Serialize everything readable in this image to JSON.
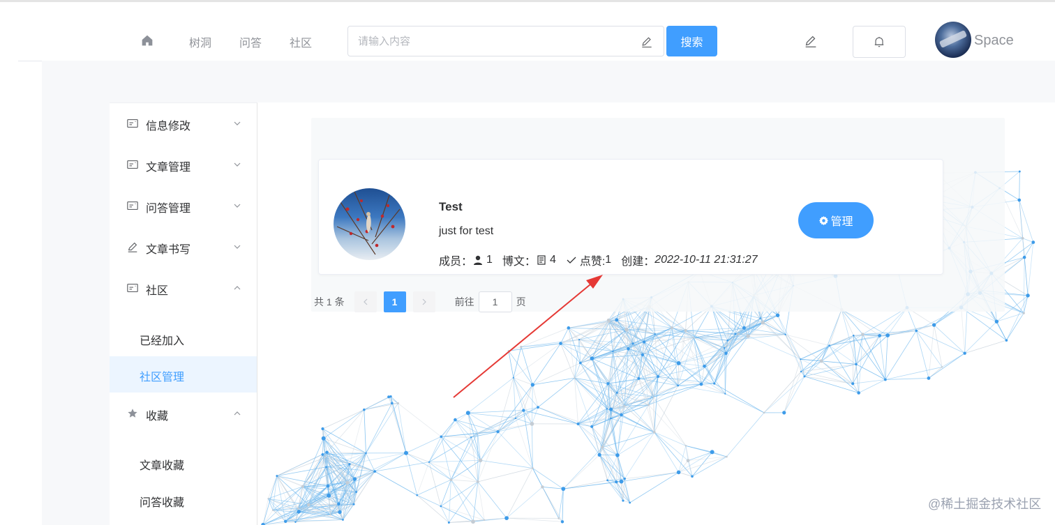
{
  "header": {
    "home_icon": "home-icon",
    "nav": [
      "树洞",
      "问答",
      "社区"
    ],
    "search": {
      "placeholder": "请输入内容",
      "value": "",
      "icon": "pencil-icon"
    },
    "search_button": "搜索",
    "write_icon": "edit-icon",
    "bell_icon": "bell-icon",
    "space_label": "Space"
  },
  "sidebar": {
    "menus": [
      {
        "label": "信息修改",
        "icon": "id-card-icon",
        "arrow": "chevron-down-icon"
      },
      {
        "label": "文章管理",
        "icon": "id-card-icon",
        "arrow": "chevron-down-icon"
      },
      {
        "label": "问答管理",
        "icon": "id-card-icon",
        "arrow": "chevron-down-icon"
      },
      {
        "label": "文章书写",
        "icon": "pencil-icon",
        "arrow": "chevron-down-icon"
      },
      {
        "label": "社区",
        "icon": "id-card-icon",
        "arrow": "chevron-up-icon"
      },
      {
        "label": "收藏",
        "icon": "star-icon",
        "arrow": "chevron-up-icon"
      }
    ],
    "community_sub": [
      "已经加入",
      "社区管理"
    ],
    "collect_sub": [
      "文章收藏",
      "问答收藏"
    ],
    "active_sub": "社区管理"
  },
  "community_card": {
    "name": "Test",
    "description": "just for test",
    "members_label": "成员：",
    "members": "1",
    "posts_label": "博文：",
    "posts": "4",
    "likes_label": "点赞: ",
    "likes": "1",
    "created_label": "创建：",
    "created": "2022-10-11 21:31:27",
    "manage_button": "管理"
  },
  "pagination": {
    "total": "共 1 条",
    "current_page": "1",
    "goto_label": "前往",
    "goto_value": "1",
    "page_unit": "页"
  },
  "watermark": "@稀土掘金技术社区",
  "colors": {
    "accent": "#409eff",
    "annotation_arrow": "#e53935"
  }
}
